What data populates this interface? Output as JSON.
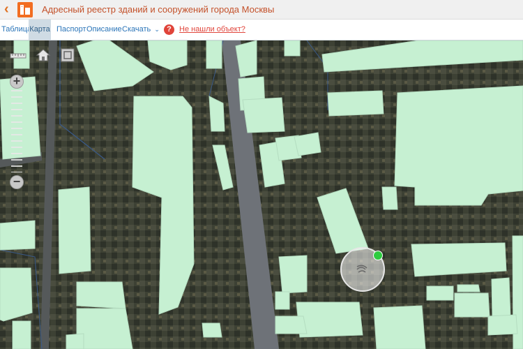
{
  "header": {
    "title": "Адресный реестр зданий и сооружений города Москвы",
    "back_icon": "chevron-left-icon",
    "logo_icon": "building-logo-icon",
    "accent_color": "#f26d21"
  },
  "tabs": [
    {
      "label": "Таблица",
      "active": false
    },
    {
      "label": "Карта",
      "active": true
    },
    {
      "label": "Паспорт",
      "active": false
    },
    {
      "label": "Описание",
      "active": false
    },
    {
      "label": "Скачать",
      "active": false,
      "dropdown": true
    }
  ],
  "help": {
    "icon_text": "?",
    "link_label": "Не нашли объект?"
  },
  "map": {
    "controls": [
      "ruler-icon",
      "home-icon",
      "fullscreen-icon"
    ],
    "zoom_in": "+",
    "zoom_out": "−",
    "building_color": "#c6f0d2"
  }
}
